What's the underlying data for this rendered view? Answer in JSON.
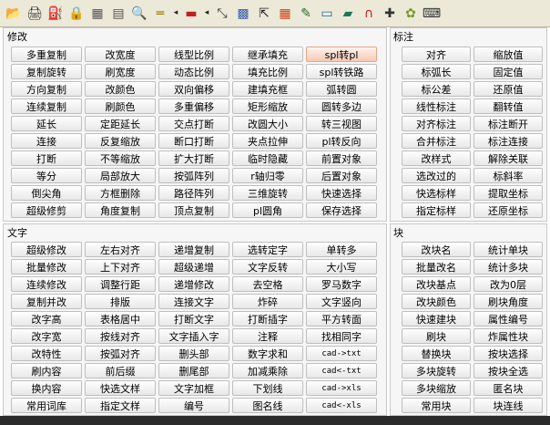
{
  "toolbar": {
    "icons": [
      "open-folder-icon",
      "print-icon",
      "stamp-icon",
      "lock-icon",
      "calculator-icon",
      "layout-icon",
      "zoom-icon",
      "ruler-icon",
      "arrow-left-icon",
      "layer-icon",
      "arrow-left-icon",
      "cursor-icon",
      "pattern-icon",
      "resize-icon",
      "color-grid-icon",
      "edit-icon",
      "screen-icon",
      "book-icon",
      "magnet-icon",
      "crosshair-icon",
      "gear-icon",
      "keyboard-icon"
    ]
  },
  "sections": {
    "modify": {
      "title": "修改",
      "rows": [
        [
          "多重复制",
          "改宽度",
          "线型比例",
          "继承填充",
          "spl转pl"
        ],
        [
          "复制旋转",
          "刷宽度",
          "动态比例",
          "填充比例",
          "spl转铁路"
        ],
        [
          "方向复制",
          "改颜色",
          "双向偏移",
          "建填充框",
          "弧转圆"
        ],
        [
          "连续复制",
          "刷颜色",
          "多重偏移",
          "矩形缩放",
          "圆转多边"
        ],
        [
          "延长",
          "定距延长",
          "交点打断",
          "改圆大小",
          "转三视图"
        ],
        [
          "连接",
          "反复缩放",
          "断口打断",
          "夹点拉伸",
          "pl转反向"
        ],
        [
          "打断",
          "不等缩放",
          "扩大打断",
          "临时隐藏",
          "前置对象"
        ],
        [
          "等分",
          "局部放大",
          "按弧阵列",
          "r轴归零",
          "后置对象"
        ],
        [
          "倒尖角",
          "方框删除",
          "路径阵列",
          "三维旋转",
          "快速选择"
        ],
        [
          "超级修剪",
          "角度复制",
          "顶点复制",
          "pl圆角",
          "保存选择"
        ]
      ]
    },
    "annotate": {
      "title": "标注",
      "rows": [
        [
          "对齐",
          "缩放值"
        ],
        [
          "标弧长",
          "固定值"
        ],
        [
          "标公差",
          "还原值"
        ],
        [
          "线性标注",
          "翻转值"
        ],
        [
          "对齐标注",
          "标注断开"
        ],
        [
          "合并标注",
          "标注连接"
        ],
        [
          "改样式",
          "解除关联"
        ],
        [
          "选改过的",
          "标斜率"
        ],
        [
          "快选标样",
          "提取坐标"
        ],
        [
          "指定标样",
          "还原坐标"
        ]
      ]
    },
    "text": {
      "title": "文字",
      "rows": [
        [
          "超级修改",
          "左右对齐",
          "递增复制",
          "选转定字",
          "单转多"
        ],
        [
          "批量修改",
          "上下对齐",
          "超级递增",
          "文字反转",
          "大小写"
        ],
        [
          "连续修改",
          "调整行距",
          "递增修改",
          "去空格",
          "罗马数字"
        ],
        [
          "复制并改",
          "排版",
          "连接文字",
          "炸碎",
          "文字竖向"
        ],
        [
          "改字高",
          "表格居中",
          "打断文字",
          "打断插字",
          "平方转面"
        ],
        [
          "改字宽",
          "按线对齐",
          "文字插入字",
          "注释",
          "找相同字"
        ],
        [
          "改特性",
          "按弧对齐",
          "删头部",
          "数字求和",
          "cad->txt"
        ],
        [
          "刷内容",
          "前后缀",
          "删尾部",
          "加减乘除",
          "cad<-txt"
        ],
        [
          "换内容",
          "快选文样",
          "文字加框",
          "下划线",
          "cad->xls"
        ],
        [
          "常用词库",
          "指定文样",
          "编号",
          "图名线",
          "cad<-xls"
        ]
      ]
    },
    "block": {
      "title": "块",
      "rows": [
        [
          "改块名",
          "统计单块"
        ],
        [
          "批量改名",
          "统计多块"
        ],
        [
          "改块基点",
          "改为0层"
        ],
        [
          "改块颜色",
          "刷块角度"
        ],
        [
          "快速建块",
          "属性编号"
        ],
        [
          "刷块",
          "炸属性块"
        ],
        [
          "替换块",
          "按块选择"
        ],
        [
          "多块旋转",
          "按块全选"
        ],
        [
          "多块缩放",
          "匿名块"
        ],
        [
          "常用块",
          "块连线"
        ]
      ]
    }
  },
  "highlight": "spl转pl",
  "colors": {
    "panel_bg": "#f6f6f6",
    "highlight": "#f6c9b5"
  }
}
